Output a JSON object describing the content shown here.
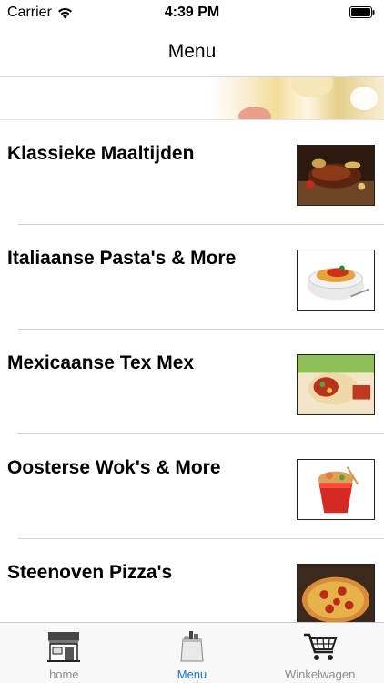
{
  "status_bar": {
    "carrier": "Carrier",
    "time": "4:39 PM"
  },
  "nav": {
    "title": "Menu"
  },
  "menu": {
    "items": [
      {
        "label": "Klassieke Maaltijden",
        "icon": "grilled-ribs-photo"
      },
      {
        "label": "Italiaanse Pasta's & More",
        "icon": "pasta-bowl-photo"
      },
      {
        "label": "Mexicaanse Tex Mex",
        "icon": "burrito-photo"
      },
      {
        "label": "Oosterse Wok's & More",
        "icon": "wok-box-photo"
      },
      {
        "label": "Steenoven Pizza's",
        "icon": "pizza-photo"
      }
    ]
  },
  "tabs": [
    {
      "label": "home",
      "icon": "store-icon",
      "active": false
    },
    {
      "label": "Menu",
      "icon": "grocery-bag-icon",
      "active": true
    },
    {
      "label": "Winkelwagen",
      "icon": "shopping-cart-icon",
      "active": false
    }
  ],
  "colors": {
    "tab_active": "#1a73d9",
    "tab_inactive": "#8e8e93"
  }
}
